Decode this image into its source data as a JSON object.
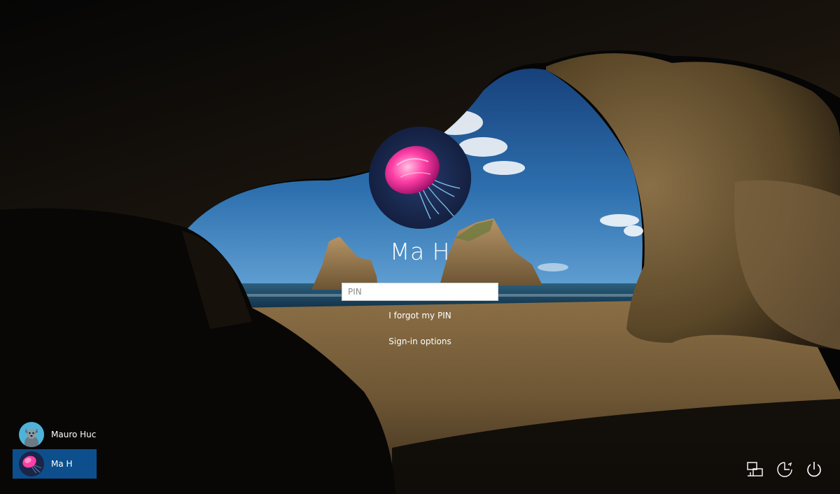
{
  "login": {
    "user_name": "Ma H",
    "pin_placeholder": "PIN",
    "forgot_pin": "I forgot my PIN",
    "sign_in_options": "Sign-in options"
  },
  "users": [
    {
      "name": "Mauro Huc",
      "avatar": "dog-avatar",
      "selected": false
    },
    {
      "name": "Ma H",
      "avatar": "jellyfish-avatar",
      "selected": true
    }
  ],
  "system_icons": [
    "network-icon",
    "ease-of-access-icon",
    "power-icon"
  ],
  "colors": {
    "selected_user_bg": "#0d4f8c",
    "input_bg": "#ffffff"
  }
}
